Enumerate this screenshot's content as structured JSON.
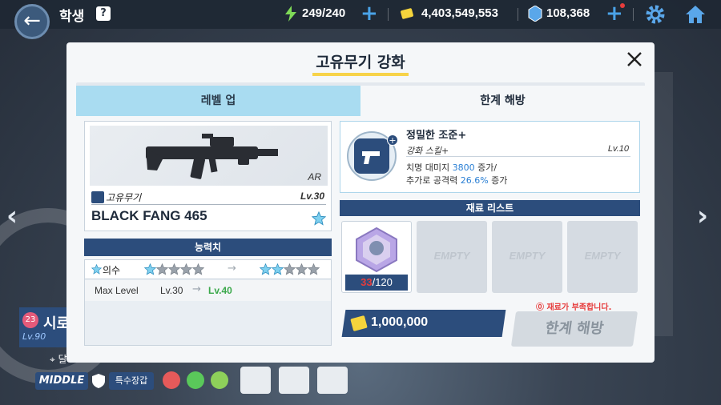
{
  "topbar": {
    "title": "학생",
    "help": "?",
    "ap": "249/240",
    "credits": "4,403,549,553",
    "gems": "108,368"
  },
  "left_panel": {
    "char_level_badge": "23",
    "char_name": "시로",
    "char_lv": "Lv.90"
  },
  "bottom": {
    "middle_label": "MIDDLE",
    "special_label": "특수장갑",
    "partial_label": "달"
  },
  "dialog": {
    "title": "고유무기 강화",
    "tabs": [
      "레벨 업",
      "한계 해방"
    ],
    "weapon": {
      "class": "AR",
      "type_label": "고유무기",
      "level": "Lv.30",
      "name": "BLACK FANG 465"
    },
    "ability": {
      "header": "능력치",
      "terrain_label": "의수",
      "terrain_from_stars": 1,
      "terrain_to_stars": 2,
      "max_level_label": "Max Level",
      "max_level_from": "Lv.30",
      "max_level_to": "Lv.40"
    },
    "skill": {
      "name": "정밀한 조준+",
      "subtitle": "강화 스킬+",
      "level": "Lv.10",
      "desc_line1_a": "치명 대미지 ",
      "desc_line1_hl": "3800",
      "desc_line1_b": " 증가/",
      "desc_line2_a": "추가로 공격력 ",
      "desc_line2_hl": "26.6%",
      "desc_line2_b": " 증가"
    },
    "materials": {
      "header": "재료 리스트",
      "have": "33",
      "need": "/120",
      "empty_label": "EMPTY"
    },
    "cost": "1,000,000",
    "warning": "⓪ 재료가 부족합니다.",
    "limit_button": "한계 해방"
  },
  "colors": {
    "navy": "#2c4d7c",
    "tab_active": "#a9dcf1",
    "accent_yellow": "#f7d34a",
    "warn_red": "#e63c3c",
    "highlight_blue": "#2a7fd4"
  }
}
